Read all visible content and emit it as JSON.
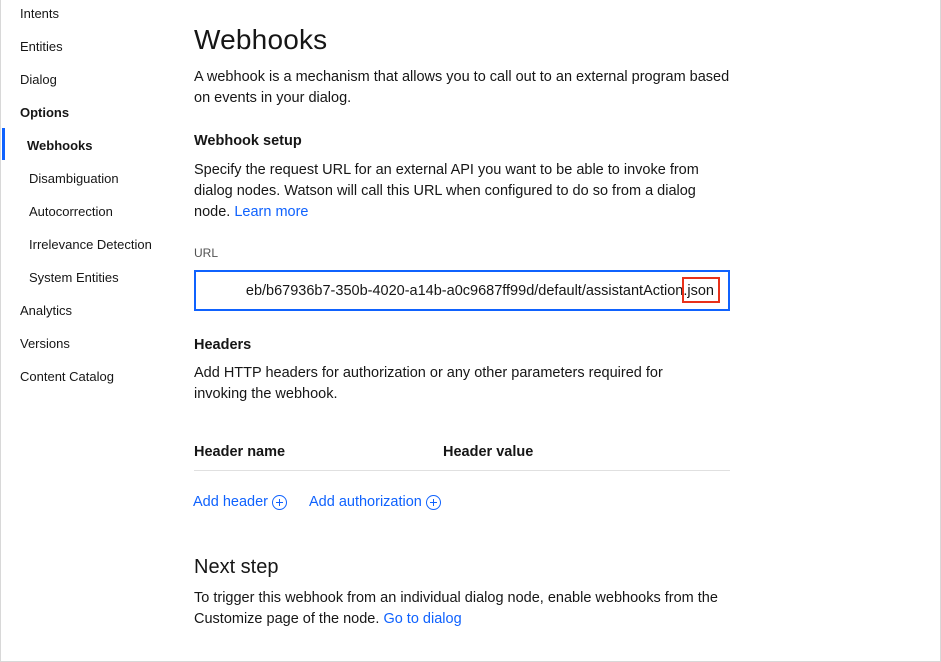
{
  "sidebar": {
    "items": [
      {
        "label": "Intents"
      },
      {
        "label": "Entities"
      },
      {
        "label": "Dialog"
      },
      {
        "label": "Options"
      },
      {
        "label": "Webhooks"
      },
      {
        "label": "Disambiguation"
      },
      {
        "label": "Autocorrection"
      },
      {
        "label": "Irrelevance Detection"
      },
      {
        "label": "System Entities"
      },
      {
        "label": "Analytics"
      },
      {
        "label": "Versions"
      },
      {
        "label": "Content Catalog"
      }
    ],
    "active": "Webhooks"
  },
  "main": {
    "title": "Webhooks",
    "intro": "A webhook is a mechanism that allows you to call out to an external program based on events in your dialog.",
    "setup": {
      "heading": "Webhook setup",
      "description": "Specify the request URL for an external API you want to be able to invoke from dialog nodes. Watson will call this URL when configured to do so from a dialog node.",
      "learn_more": "Learn more",
      "url_label": "URL",
      "url_value": "eb/b67936b7-350b-4020-a14b-a0c9687ff99d/default/assistantAction.json"
    },
    "headers": {
      "heading": "Headers",
      "description": "Add HTTP headers for authorization or any other parameters required for invoking the webhook.",
      "columns": [
        "Header name",
        "Header value"
      ],
      "add_header": "Add header",
      "add_authorization": "Add authorization"
    },
    "next_step": {
      "heading": "Next step",
      "description": "To trigger this webhook from an individual dialog node, enable webhooks from the Customize page of the node.",
      "link": "Go to dialog"
    }
  },
  "colors": {
    "accent": "#0f62fe",
    "highlight": "#e8311a"
  }
}
